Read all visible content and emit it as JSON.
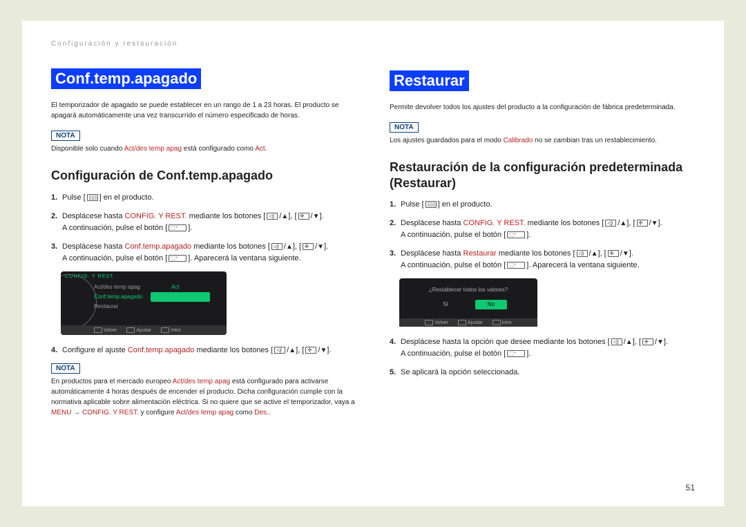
{
  "header": "Configuración y restauración",
  "pageNum": "51",
  "left": {
    "title": "Conf.temp.apagado",
    "intro": "El temporizador de apagado se puede establecer en un rango de 1 a 23 horas. El producto se apagará automáticamente una vez transcurrido el número especificado de horas.",
    "notaLabel": "NOTA",
    "notaPre": "Disponible solo cuando ",
    "notaRed": "Act/des temp apag",
    "notaMid": " está configurado como ",
    "notaRed2": "Act",
    "subhead": "Configuración de Conf.temp.apagado",
    "step1a": "Pulse ",
    "step1b": " en el producto.",
    "step2a": "Desplácese hasta ",
    "step2b": "CONFIG. Y REST.",
    "step2c": " mediante los botones ",
    "stepCont": "A continuación, pulse el botón ",
    "step3a": "Desplácese hasta ",
    "step3b": "Conf.temp.apagado",
    "step3c": " mediante los botones ",
    "step3d": ". Aparecerá la ventana siguiente.",
    "shotMenuTitle": "CONFIG. Y REST.",
    "shotItem1": "Act/des temp apag",
    "shotItem1v": "Act",
    "shotItem2": "Conf.temp.apagado",
    "shotItem3": "Restaurar",
    "shotSelect": "",
    "footVolver": "Volver",
    "footAjustar": "Ajustar",
    "footIntro": "Intro",
    "step4a": "Configure el ajuste ",
    "step4b": "Conf.temp.apagado",
    "step4c": " mediante los botones ",
    "nota2": "En productos para el mercado europeo ",
    "nota2r1": "Act/des temp apag",
    "nota2b": " está configurado para activarse automáticamente 4 horas después de encender el producto. Dicha configuración cumple con la normativa aplicable sobre alimentación eléctrica. Si no quiere que se active el temporizador, vaya a ",
    "nota2r2": "MENU",
    "nota2arrow": " → ",
    "nota2r3": "CONFIG. Y REST.",
    "nota2c": " y configure ",
    "nota2r4": "Act/des temp apag",
    "nota2d": " como ",
    "nota2r5": "Des.",
    "nota2e": "."
  },
  "right": {
    "title": "Restaurar",
    "intro": "Permite devolver todos los ajustes del producto a la configuración de fábrica predeterminada.",
    "nota": "Los ajustes guardados para el modo ",
    "notaRed": "Calibrado",
    "notaEnd": " no se cambian tras un restablecimiento.",
    "subhead": "Restauración de la configuración predeterminada (Restaurar)",
    "step3b": "Restaurar",
    "shotQuestion": "¿Restablecer todos los valores?",
    "shotYes": "Sí",
    "shotNo": "No",
    "step4": "Desplácese hasta la opción que desee mediante los botones ",
    "step5": "Se aplicará la opción seleccionada."
  }
}
